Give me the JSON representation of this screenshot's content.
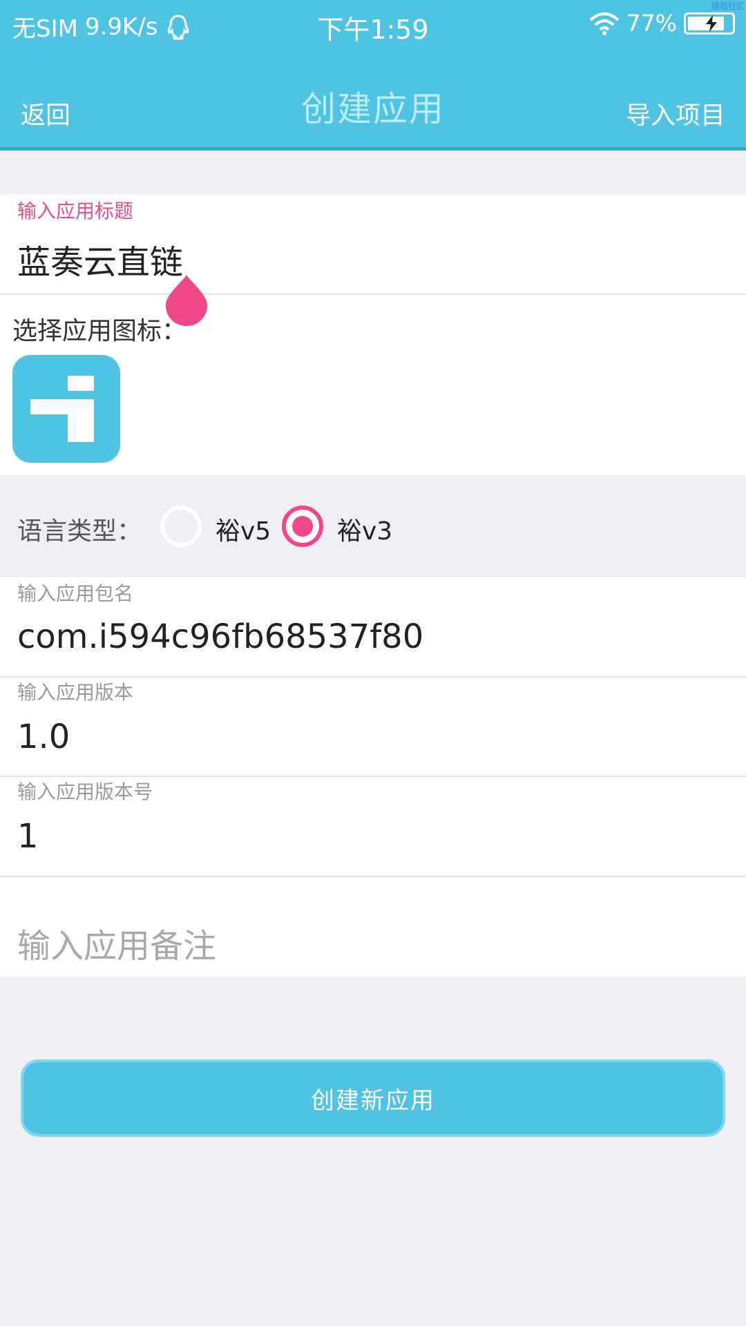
{
  "status_bar": {
    "carrier": "无SIM",
    "speed": "9.9K/s",
    "time": "下午1:59",
    "battery": "77%",
    "watermark": "搜狐社区",
    "icons": [
      "qq-icon",
      "wifi-icon",
      "battery-icon",
      "charging-icon"
    ]
  },
  "nav": {
    "back": "返回",
    "title": "创建应用",
    "import": "导入项目"
  },
  "form": {
    "title_label": "输入应用标题",
    "title_value": "蓝奏云直链",
    "icon_label": "选择应用图标：",
    "language_label": "语言类型：",
    "language_options": [
      {
        "label": "裕v5",
        "selected": false
      },
      {
        "label": "裕v3",
        "selected": true
      }
    ],
    "package_label": "输入应用包名",
    "package_value": "com.i594c96fb68537f80",
    "version_label": "输入应用版本",
    "version_value": "1.0",
    "version_code_label": "输入应用版本号",
    "version_code_value": "1",
    "remark_placeholder": "输入应用备注"
  },
  "actions": {
    "create": "创建新应用"
  },
  "colors": {
    "primary": "#4fc3e2",
    "accent": "#f04886",
    "background": "#eeeef3"
  }
}
